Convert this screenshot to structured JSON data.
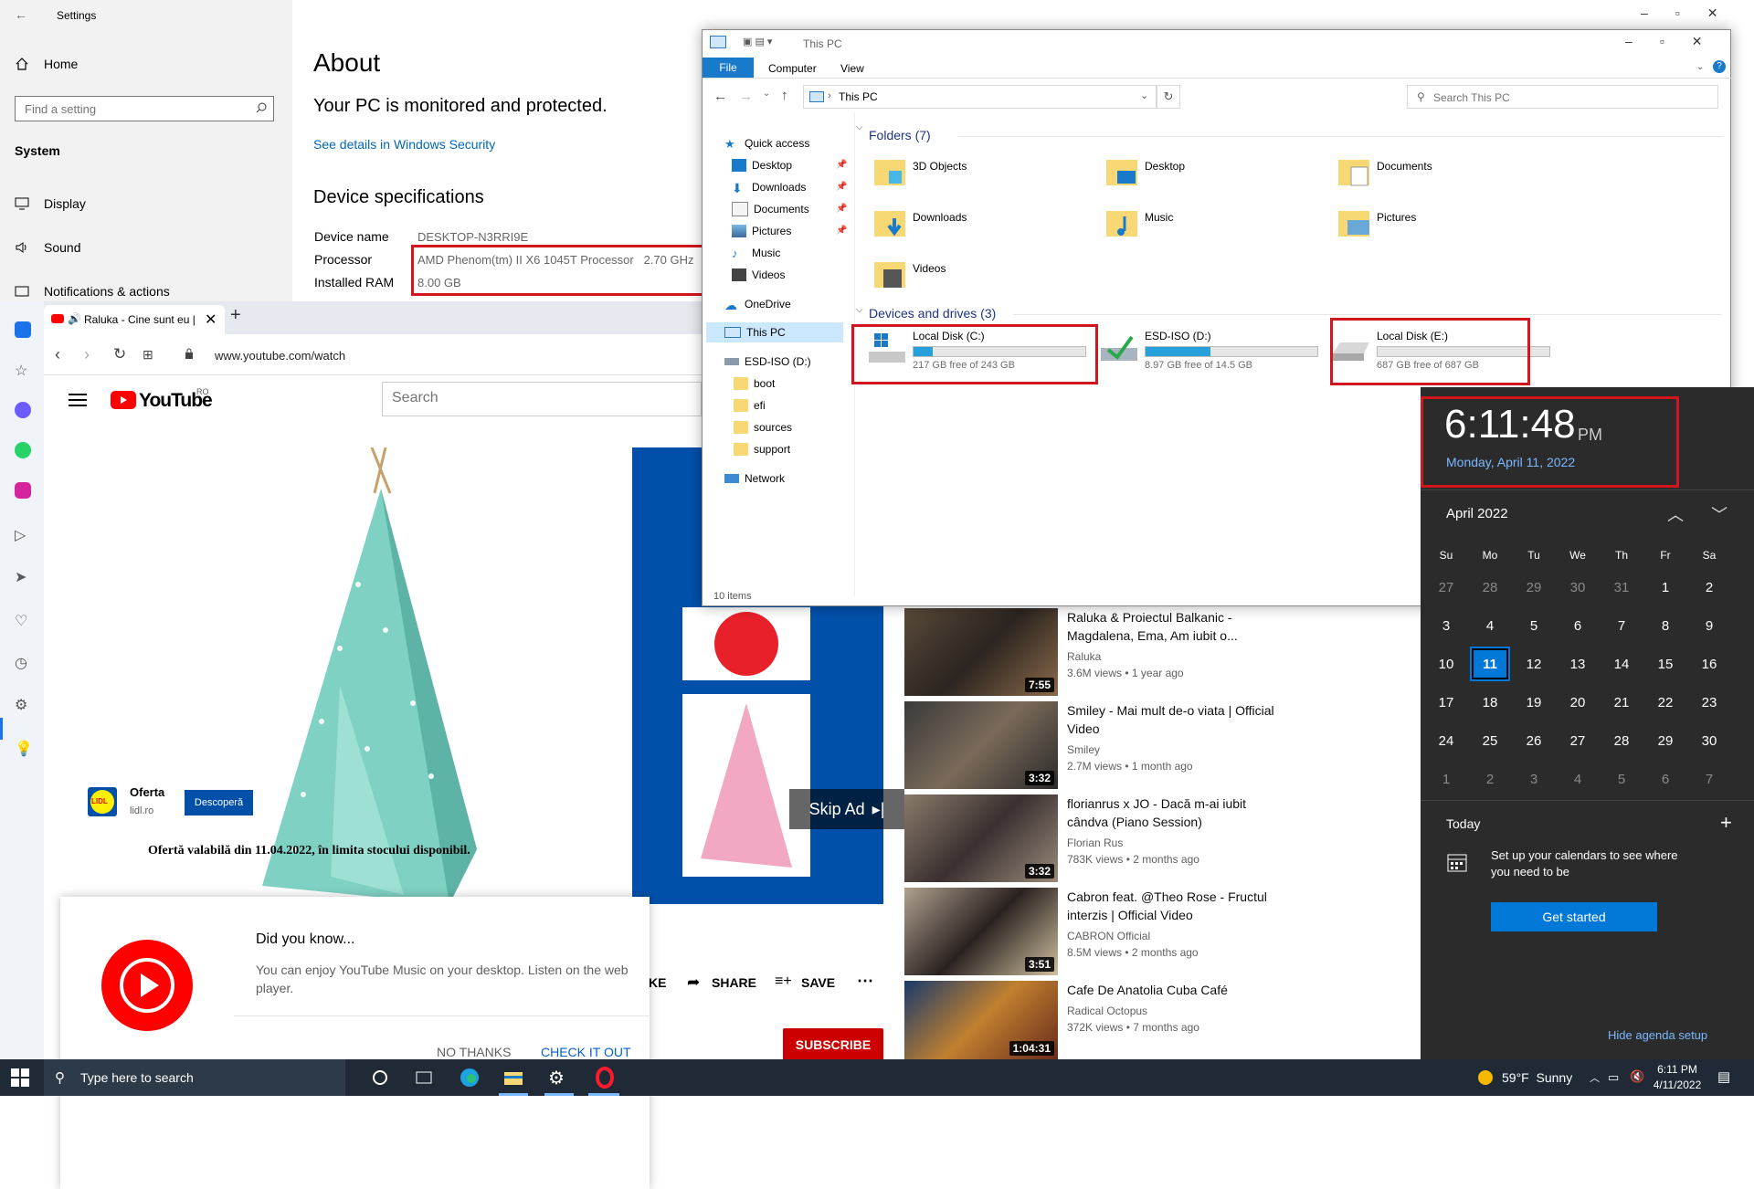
{
  "settings": {
    "window_title": "Settings",
    "home": "Home",
    "search_placeholder": "Find a setting",
    "section": "System",
    "nav": [
      "Display",
      "Sound",
      "Notifications & actions"
    ],
    "about_heading": "About",
    "protection": "Your PC is monitored and protected.",
    "security_link": "See details in Windows Security",
    "device_specs": "Device specifications",
    "specs": [
      {
        "label": "Device name",
        "value": "DESKTOP-N3RRI9E"
      },
      {
        "label": "Processor",
        "value": "AMD Phenom(tm) II X6 1045T Processor   2.70 GHz"
      },
      {
        "label": "Installed RAM",
        "value": "8.00 GB"
      }
    ]
  },
  "explorer": {
    "title": "This PC",
    "ribbon_tabs": [
      "File",
      "Computer",
      "View"
    ],
    "address": "This PC",
    "search_placeholder": "Search This PC",
    "folders_header": "Folders (7)",
    "folders": [
      "3D Objects",
      "Desktop",
      "Documents",
      "Downloads",
      "Music",
      "Pictures",
      "Videos"
    ],
    "drives_header": "Devices and drives (3)",
    "drives": [
      {
        "name": "Local Disk (C:)",
        "free": "217 GB free of 243 GB",
        "used_fraction": 0.11
      },
      {
        "name": "ESD-ISO (D:)",
        "free": "8.97 GB free of 14.5 GB",
        "used_fraction": 0.38
      },
      {
        "name": "Local Disk (E:)",
        "free": "687 GB free of 687 GB",
        "used_fraction": 0.0
      }
    ],
    "nav": {
      "quick_access": "Quick access",
      "quick_items": [
        "Desktop",
        "Downloads",
        "Documents",
        "Pictures",
        "Music",
        "Videos"
      ],
      "onedrive": "OneDrive",
      "this_pc": "This PC",
      "esd": "ESD-ISO (D:)",
      "esd_items": [
        "boot",
        "efi",
        "sources",
        "support"
      ],
      "network": "Network"
    },
    "status": "10 items"
  },
  "browser": {
    "tab_title": "Raluka - Cine sunt eu |",
    "url": "www.youtube.com/watch",
    "yt_logo": "YouTube",
    "yt_region": "RO",
    "search_placeholder": "Search",
    "ad": {
      "brand": "Oferta",
      "domain": "lidl.ro",
      "brand_logo": "LIDL",
      "cta": "Descoperă",
      "offer": "Ofertă valabilă din 11.04.2022, în limita stocului disponibil.",
      "skip": "Skip Ad"
    },
    "popup": {
      "title": "Did you know...",
      "body": "You can enjoy YouTube Music on your desktop. Listen on the web player.",
      "no": "NO THANKS",
      "yes": "CHECK IT OUT"
    },
    "actions": {
      "like": "KE",
      "share": "SHARE",
      "save": "SAVE",
      "subscribe": "SUBSCRIBE"
    },
    "videos": [
      {
        "title": "Raluka & Proiectul Balkanic - Magdalena, Ema, Am iubit o...",
        "channel": "Raluka",
        "meta": "3.6M views • 1 year ago",
        "duration": "7:55"
      },
      {
        "title": "Smiley - Mai mult de-o viata | Official Video",
        "channel": "Smiley",
        "meta": "2.7M views • 1 month ago",
        "duration": "3:32"
      },
      {
        "title": "florianrus x JO - Dacă m-ai iubit cândva (Piano Session)",
        "channel": "Florian Rus",
        "meta": "783K views • 2 months ago",
        "duration": "3:32"
      },
      {
        "title": "Cabron feat. @Theo Rose - Fructul interzis | Official Video",
        "channel": "CABRON Official",
        "meta": "8.5M views • 2 months ago",
        "duration": "3:51"
      },
      {
        "title": "Cafe De Anatolia Cuba Café",
        "channel": "Radical Octopus",
        "meta": "372K views • 7 months ago",
        "duration": "1:04:31"
      }
    ]
  },
  "clock": {
    "time": "6:11:48",
    "ampm": "PM",
    "date": "Monday, April 11, 2022",
    "month": "April 2022",
    "dow": [
      "Su",
      "Mo",
      "Tu",
      "We",
      "Th",
      "Fr",
      "Sa"
    ],
    "weeks": [
      [
        "27",
        "28",
        "29",
        "30",
        "31",
        "1",
        "2"
      ],
      [
        "3",
        "4",
        "5",
        "6",
        "7",
        "8",
        "9"
      ],
      [
        "10",
        "11",
        "12",
        "13",
        "14",
        "15",
        "16"
      ],
      [
        "17",
        "18",
        "19",
        "20",
        "21",
        "22",
        "23"
      ],
      [
        "24",
        "25",
        "26",
        "27",
        "28",
        "29",
        "30"
      ],
      [
        "1",
        "2",
        "3",
        "4",
        "5",
        "6",
        "7"
      ]
    ],
    "today_label": "Today",
    "agenda_text": "Set up your calendars to see where you need to be",
    "get_started": "Get started",
    "hide_agenda": "Hide agenda setup"
  },
  "taskbar": {
    "search_placeholder": "Type here to search",
    "weather": "59°F  Sunny",
    "time": "6:11 PM",
    "date": "4/11/2022"
  },
  "colors": {
    "accent": "#0078d7",
    "highlight_box": "#d1171d",
    "youtube_red": "#ff0000"
  }
}
